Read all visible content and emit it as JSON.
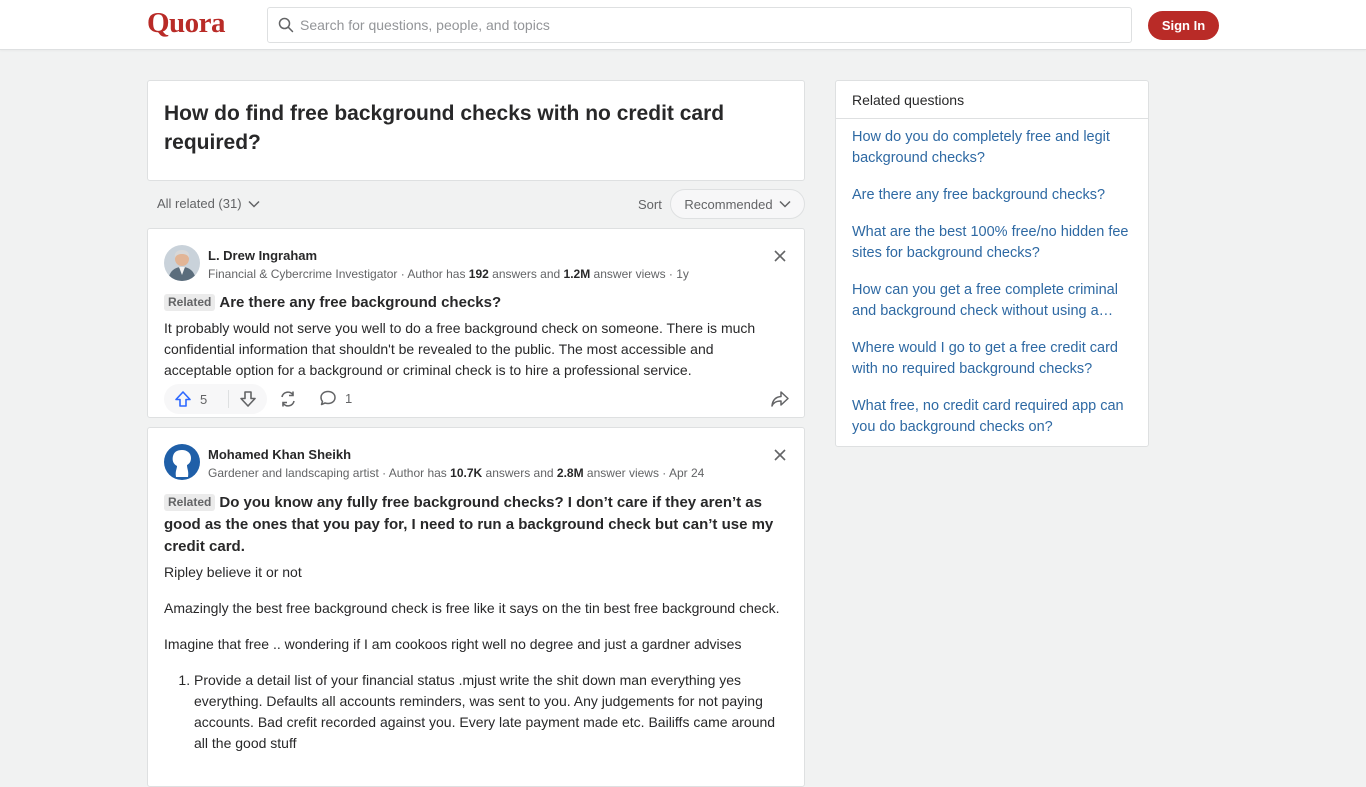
{
  "header": {
    "logo": "Quora",
    "search_placeholder": "Search for questions, people, and topics",
    "signin_label": "Sign In"
  },
  "question": {
    "title": "How do find free background checks with no credit card required?"
  },
  "filters": {
    "all_related": "All related (31)",
    "sort_label": "Sort",
    "sort_value": "Recommended"
  },
  "answers": [
    {
      "author": "L. Drew Ingraham",
      "credential": "Financial & Cybercrime Investigator · Author has ",
      "answer_count": "192",
      "answers_word": " answers and ",
      "views": "1.2M",
      "views_word": " answer views · 1y",
      "related_tag": "Related",
      "related_question": "Are there any free background checks?",
      "body": "It probably would not serve you well to do a free background check on someone. There is much confidential information that shouldn't be revealed to the public. The most accessible and acceptable option for a background or criminal check is to hire a professional service.",
      "upvotes": "5",
      "comments": "1"
    },
    {
      "author": "Mohamed Khan Sheikh",
      "credential": "Gardener and landscaping artist · Author has ",
      "answer_count": "10.7K",
      "answers_word": " answers and ",
      "views": "2.8M",
      "views_word": " answer views · Apr 24",
      "related_tag": "Related",
      "related_question": "Do you know any fully free background checks? I don’t care if they aren’t as good as the ones that you pay for, I need to run a background check but can’t use my credit card.",
      "paragraphs": [
        "Ripley believe it or not",
        "Amazingly the best free background check is free like it says on the tin best free background check.",
        "Imagine that free .. wondering if I am cookoos right well no degree and just a gardner advises"
      ],
      "list_items": [
        "Provide a detail list of your financial status .mjust write the shit down man everything yes everything. Defaults all accounts reminders, was sent to you. Any judgements for not paying accounts. Bad crefit recorded against you. Every late payment made etc. Bailiffs came around all the good stuff"
      ]
    }
  ],
  "related": {
    "heading": "Related questions",
    "items": [
      "How do you do completely free and legit background checks?",
      "Are there any free background checks?",
      "What are the best 100% free/no hidden fee sites for background checks?",
      "How can you get a free complete criminal and background check without using a…",
      "Where would I go to get a free credit card with no required background checks?",
      "What free, no credit card required app can you do background checks on?"
    ]
  },
  "colors": {
    "brand": "#b92b27",
    "link": "#2e69a3",
    "upvote": "#2e69ff"
  }
}
